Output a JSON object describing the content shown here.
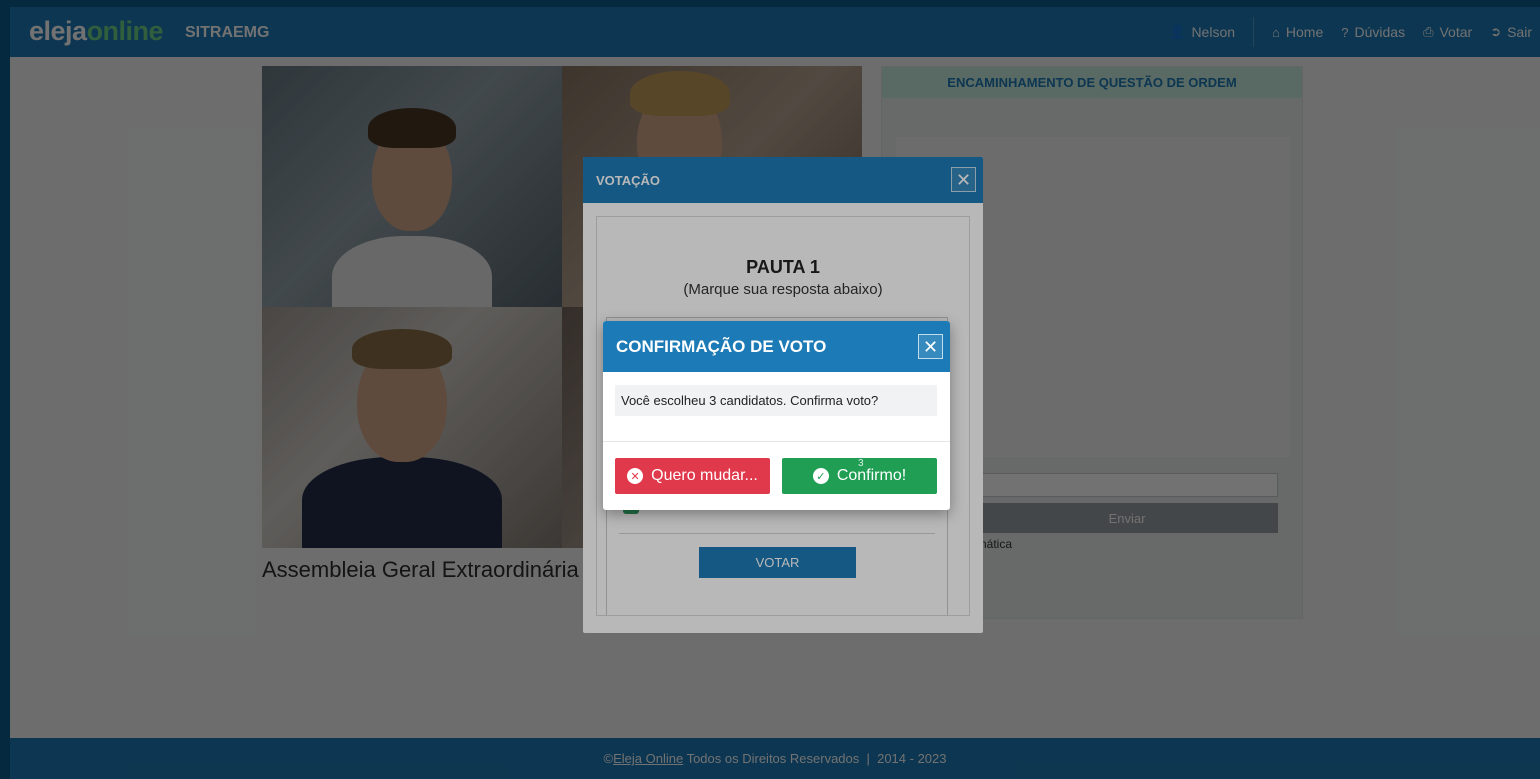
{
  "brand": {
    "logo_part1": "eleja",
    "logo_part2": "online",
    "org": "SITRAEMG"
  },
  "nav": {
    "user": "Nelson",
    "items": [
      {
        "label": "Home",
        "icon": "home-icon"
      },
      {
        "label": "Dúvidas",
        "icon": "question-icon"
      },
      {
        "label": "Votar",
        "icon": "print-icon"
      },
      {
        "label": "Sair",
        "icon": "sign-out-icon"
      }
    ]
  },
  "video": {
    "title": "Assembleia Geral Extraordinária"
  },
  "side": {
    "header": "ENCAMINHAMENTO DE QUESTÃO DE ORDEM",
    "send_label": "Enviar",
    "auto_text": "omática"
  },
  "vote_modal": {
    "title": "VOTAÇÃO",
    "pauta": "PAUTA 1",
    "subtitle": "(Marque sua resposta abaixo)",
    "vote_button": "VOTAR"
  },
  "confirm_modal": {
    "title": "CONFIRMAÇÃO DE VOTO",
    "message": "Você escolheu 3 candidatos. Confirma voto?",
    "change_label": "Quero mudar...",
    "confirm_label": "Confirmo!",
    "countdown": "3"
  },
  "footer": {
    "prefix": "©",
    "link": "Eleja Online",
    "text": " Todos os Direitos Reservados  |  2014 - 2023"
  },
  "colors": {
    "primary": "#1c7ab6",
    "danger": "#e0394b",
    "success": "#1f9e54",
    "side_header_bg": "#c8ecdd"
  }
}
